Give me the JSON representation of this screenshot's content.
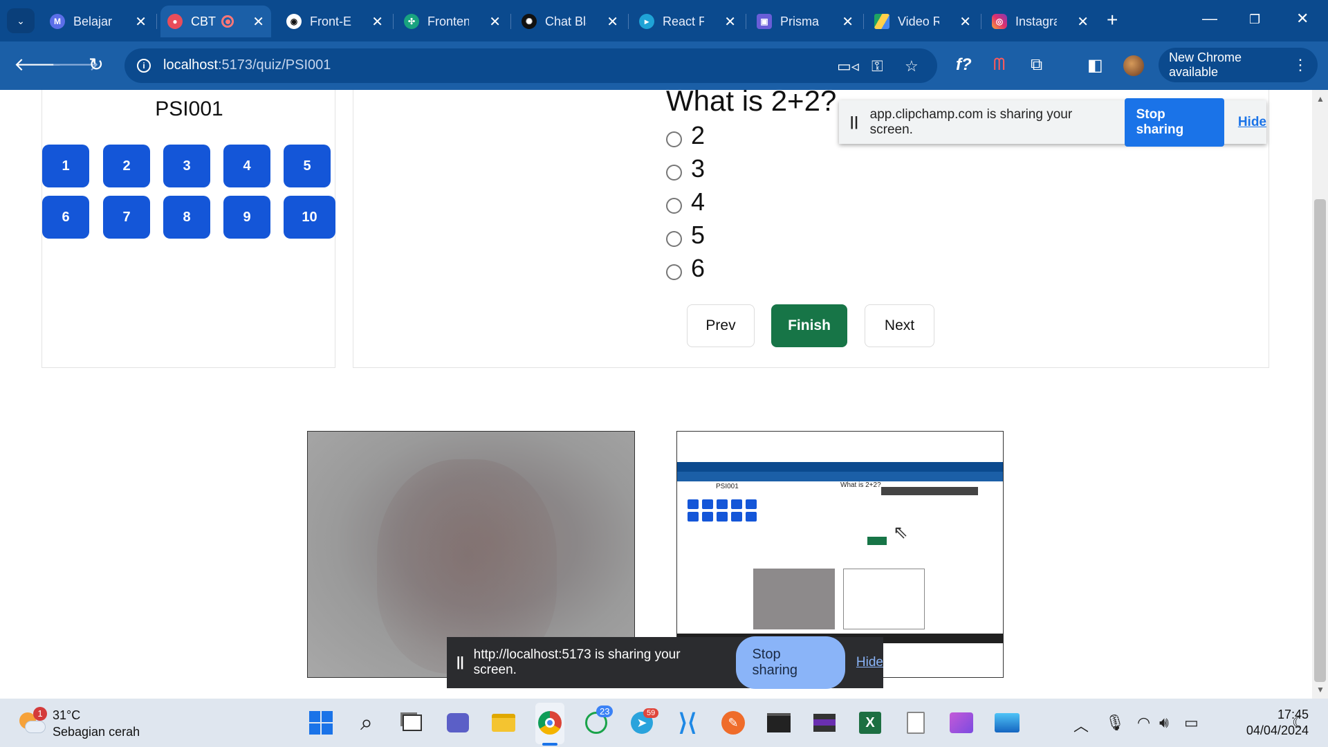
{
  "browser": {
    "tabs": [
      {
        "title": "Belajar Full",
        "favicon": "meet-icon",
        "active": false
      },
      {
        "title": "CBT",
        "favicon": "react-icon",
        "active": true,
        "recording": true
      },
      {
        "title": "Front-End",
        "favicon": "github-icon",
        "active": false
      },
      {
        "title": "Frontend",
        "favicon": "chatgpt-icon",
        "active": false
      },
      {
        "title": "Chat Black",
        "favicon": "chatbox-icon",
        "active": false
      },
      {
        "title": "React Fo",
        "favicon": "react-play-icon",
        "active": false
      },
      {
        "title": "Prisma S",
        "favicon": "teams-icon",
        "active": false
      },
      {
        "title": "Video R",
        "favicon": "drive-icon",
        "active": false
      },
      {
        "title": "Instagra",
        "favicon": "instagram-icon",
        "active": false
      }
    ],
    "url_host": "localhost",
    "url_path": ":5173/quiz/PSI001",
    "update_label": "New Chrome available"
  },
  "sidebar": {
    "quiz_code": "PSI001",
    "numbers": [
      "1",
      "2",
      "3",
      "4",
      "5",
      "6",
      "7",
      "8",
      "9",
      "10"
    ]
  },
  "quiz": {
    "question": "What is 2+2?",
    "options": [
      "2",
      "3",
      "4",
      "5",
      "6"
    ],
    "prev_label": "Prev",
    "finish_label": "Finish",
    "next_label": "Next"
  },
  "share_banner_top": {
    "text": "app.clipchamp.com is sharing your screen.",
    "stop_label": "Stop sharing",
    "hide_label": "Hide"
  },
  "share_banner_bottom": {
    "text": "http://localhost:5173 is sharing your screen.",
    "stop_label": "Stop sharing",
    "hide_label": "Hide"
  },
  "taskbar": {
    "weather_badge": "1",
    "temperature": "31°C",
    "condition": "Sebagian cerah",
    "whatsapp_badge": "23",
    "telegram_badge": "59",
    "time": "17:45",
    "date": "04/04/2024"
  },
  "colors": {
    "chrome_dark": "#0b4a8e",
    "chrome_toolbar": "#1b5fa7",
    "question_button": "#1456d8",
    "finish_button": "#177547",
    "stop_sharing_top": "#1a73e8",
    "stop_sharing_bottom": "#8ab4f8"
  }
}
